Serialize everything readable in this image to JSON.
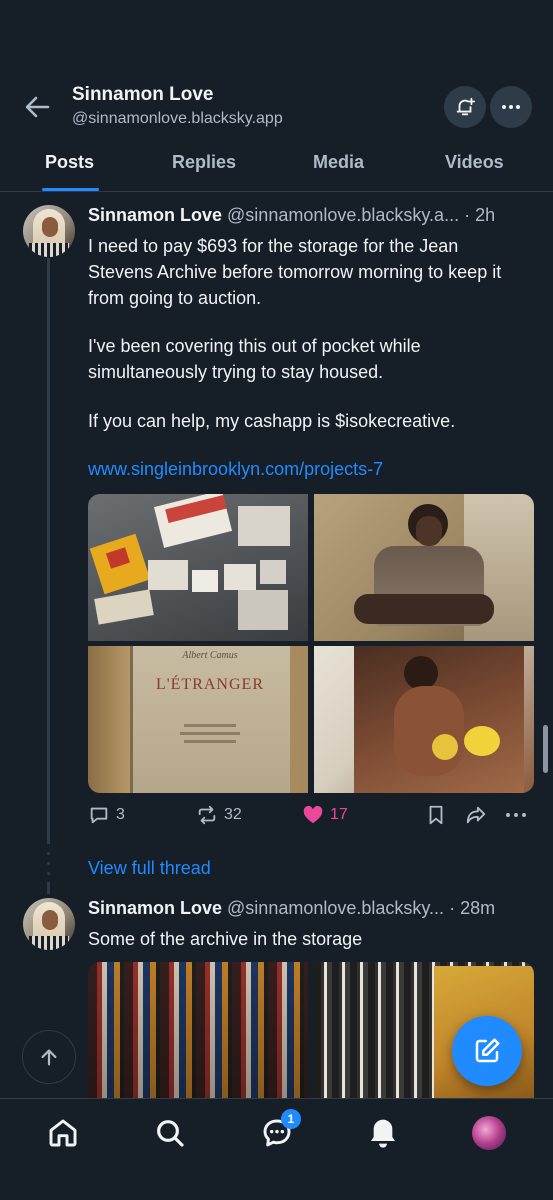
{
  "header": {
    "title": "Sinnamon Love",
    "handle": "@sinnamonlove.blacksky.app"
  },
  "tabs": [
    {
      "label": "Posts"
    },
    {
      "label": "Replies"
    },
    {
      "label": "Media"
    },
    {
      "label": "Videos"
    }
  ],
  "posts": [
    {
      "name": "Sinnamon Love",
      "handle": "@sinnamonlove.blacksky.a...",
      "time": "· 2h",
      "paragraphs": [
        "I need to pay $693 for the storage for the Jean Stevens Archive before tomorrow morning to keep it from going to auction.",
        "I've been covering this out of pocket while simultaneously trying to stay housed.",
        "If you can help, my cashapp is $isokecreative."
      ],
      "link": "www.singleinbrooklyn.com/projects-7",
      "image_texts": {
        "book_author": "Albert Camus",
        "book_title": "L'ÉTRANGER"
      },
      "counts": {
        "replies": "3",
        "reposts": "32",
        "likes": "17"
      }
    },
    {
      "name": "Sinnamon Love",
      "handle": "@sinnamonlove.blacksky...",
      "time": "· 28m",
      "text": "Some of the archive in the storage"
    }
  ],
  "view_full_thread": "View full thread",
  "notifications_badge": "1",
  "colors": {
    "background": "#161e27",
    "accent": "#208bfe",
    "like": "#ec4899",
    "muted": "#aebbc9"
  },
  "icons": [
    "back-arrow-icon",
    "bell-plus-icon",
    "more-icon",
    "reply-icon",
    "repost-icon",
    "heart-icon",
    "bookmark-icon",
    "share-icon",
    "compose-icon",
    "arrow-up-icon",
    "home-icon",
    "search-icon",
    "chat-icon",
    "bell-icon"
  ]
}
